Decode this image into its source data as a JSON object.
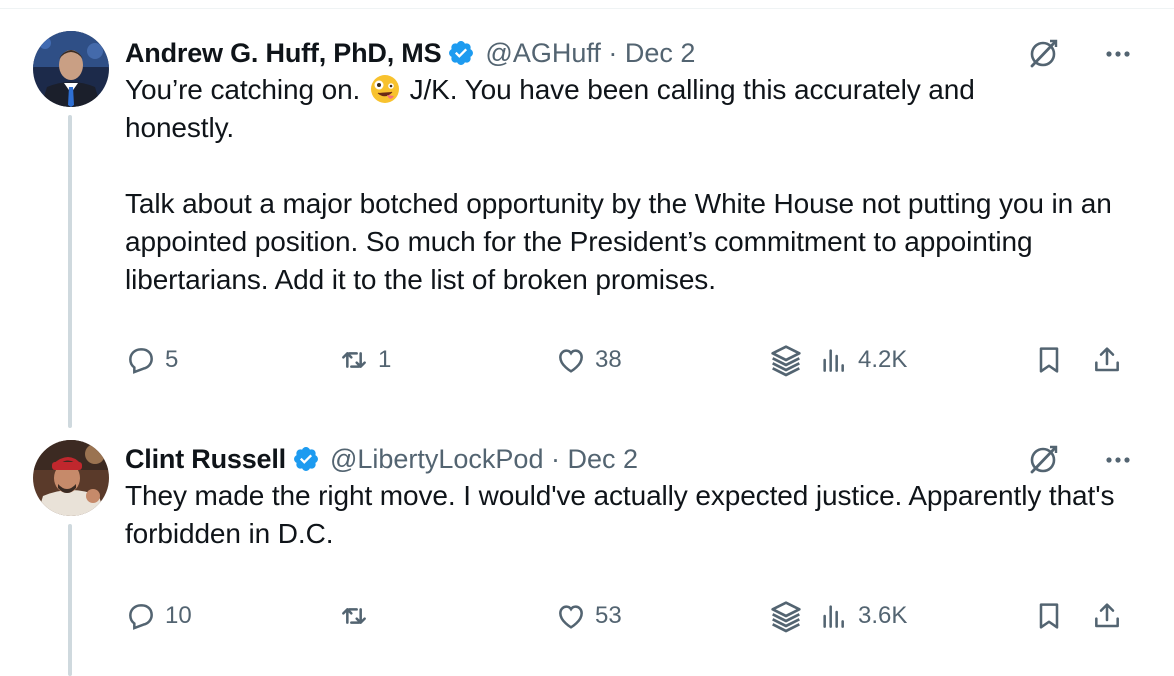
{
  "tweets": [
    {
      "author": "Andrew G. Huff, PhD, MS",
      "handle": "@AGHuff",
      "date": "Dec 2",
      "handle_date": "@AGHuff · Dec 2",
      "text_before_emoji": "You’re catching on. ",
      "emoji": "zany-face",
      "text_after_emoji": " J/K.  You have been calling this accurately and\nhonestly.\n\nTalk about a major botched opportunity by the White House not putting you in an appointed position. So much for the President’s commitment to appointing libertarians. Add it to the list of broken promises.",
      "replies": "5",
      "reposts": "1",
      "likes": "38",
      "views": "4.2K"
    },
    {
      "author": "Clint Russell",
      "handle": "@LibertyLockPod",
      "date": "Dec 2",
      "handle_date": "@LibertyLockPod · Dec 2",
      "text": "They made the right move. I would've actually expected justice. Apparently that's forbidden in D.C.",
      "replies": "10",
      "reposts": "",
      "likes": "53",
      "views": "3.6K"
    }
  ],
  "colors": {
    "text": "#0f1419",
    "muted": "#536471",
    "verified": "#1d9bf0",
    "thread_line": "#cfd9de"
  },
  "icons": [
    "verified-badge-icon",
    "grok-icon",
    "more-icon",
    "reply-icon",
    "repost-icon",
    "like-icon",
    "grok-stack-icon",
    "views-icon",
    "bookmark-icon",
    "share-icon"
  ]
}
